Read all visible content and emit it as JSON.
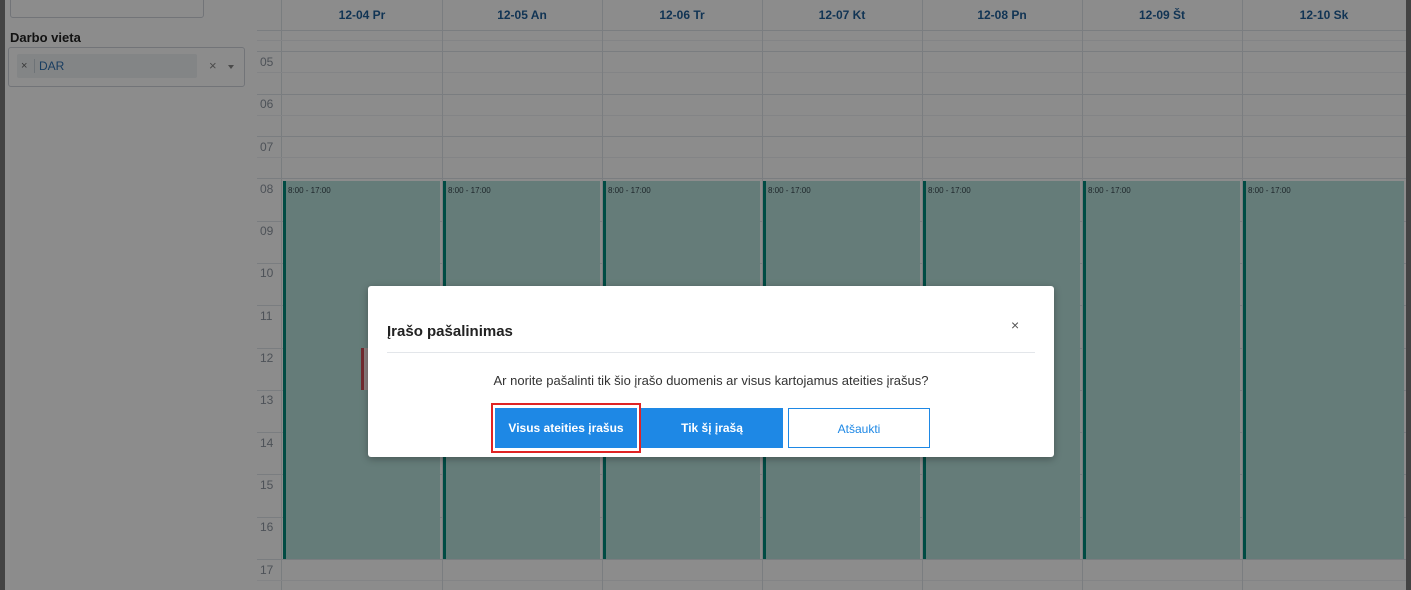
{
  "sidebar": {
    "filter_label": "Darbo vieta",
    "selected_chip": "DAR",
    "chip_remove": "×",
    "clear_symbol": "×"
  },
  "calendar": {
    "days": [
      "12-04 Pr",
      "12-05 An",
      "12-06 Tr",
      "12-07 Kt",
      "12-08 Pn",
      "12-09 Št",
      "12-10 Sk"
    ],
    "hours": [
      "05",
      "06",
      "07",
      "08",
      "09",
      "10",
      "11",
      "12",
      "13",
      "14",
      "15",
      "16",
      "17"
    ],
    "event_time": "8:00 - 17:00"
  },
  "modal": {
    "title": "Įrašo pašalinimas",
    "close_symbol": "×",
    "message": "Ar norite pašalinti tik šio įrašo duomenis ar visus kartojamus ateities įrašus?",
    "btn_all_future": "Visus ateities įrašus",
    "btn_only_this": "Tik šį įrašą",
    "btn_cancel": "Atšaukti"
  },
  "colors": {
    "event_bg": "#b9e2dc",
    "event_border": "#00897b",
    "accent": "#1e88e5",
    "highlight": "#e02424"
  }
}
